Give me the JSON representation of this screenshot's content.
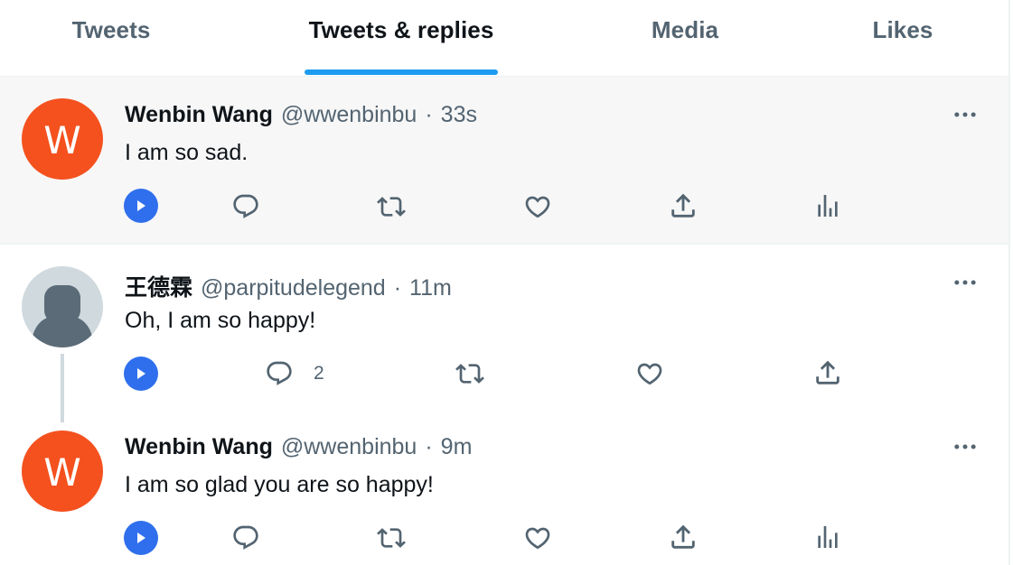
{
  "tabs": [
    {
      "label": "Tweets",
      "active": false
    },
    {
      "label": "Tweets & replies",
      "active": true
    },
    {
      "label": "Media",
      "active": false
    },
    {
      "label": "Likes",
      "active": false
    }
  ],
  "colors": {
    "accent": "#1d9bf0",
    "avatar_orange": "#f4511e",
    "play_button": "#2f6fed",
    "muted_text": "#536471"
  },
  "tweets": [
    {
      "name": "Wenbin Wang",
      "handle": "@wwenbinbu",
      "separator": "·",
      "time": "33s",
      "text": "I am so sad.",
      "avatar_letter": "W",
      "actions": [
        "play-icon",
        "reply-icon",
        "retweet-icon",
        "like-icon",
        "share-icon",
        "analytics-icon"
      ]
    },
    {
      "name": "王德霖",
      "handle": "@parpitudelegend",
      "separator": "·",
      "time": "11m",
      "text": "Oh, I am so happy!",
      "avatar_letter": "",
      "reply_count": "2",
      "actions": [
        "play-icon",
        "reply-icon",
        "retweet-icon",
        "like-icon",
        "share-icon"
      ]
    },
    {
      "name": "Wenbin Wang",
      "handle": "@wwenbinbu",
      "separator": "·",
      "time": "9m",
      "text": "I am so glad you are so happy!",
      "avatar_letter": "W",
      "actions": [
        "play-icon",
        "reply-icon",
        "retweet-icon",
        "like-icon",
        "share-icon",
        "analytics-icon"
      ]
    }
  ]
}
